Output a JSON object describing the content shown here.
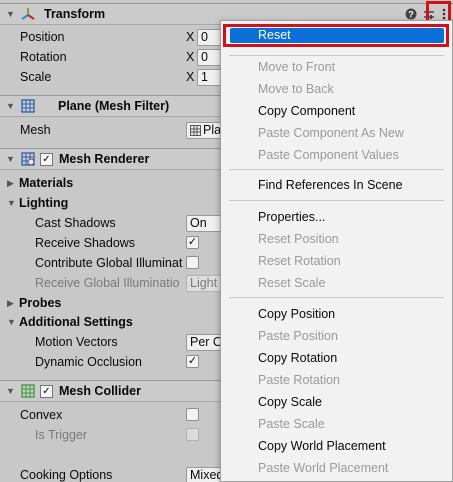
{
  "transform": {
    "title": "Transform",
    "position_label": "Position",
    "rotation_label": "Rotation",
    "scale_label": "Scale",
    "axis_x": "X",
    "position_x": "0",
    "rotation_x": "0",
    "scale_x": "1"
  },
  "plane": {
    "title": "Plane (Mesh Filter)",
    "mesh_label": "Mesh",
    "mesh_value": "Pla"
  },
  "renderer": {
    "title": "Mesh Renderer",
    "materials": "Materials",
    "lighting": "Lighting",
    "cast_shadows_label": "Cast Shadows",
    "cast_shadows_value": "On",
    "receive_shadows_label": "Receive Shadows",
    "contribute_gi_label": "Contribute Global Illuminat",
    "receive_gi_label": "Receive Global Illuminatio",
    "receive_gi_value": "Light",
    "probes": "Probes",
    "additional": "Additional Settings",
    "motion_vectors_label": "Motion Vectors",
    "motion_vectors_value": "Per O",
    "dynamic_occlusion_label": "Dynamic Occlusion",
    "check_mark": "✓"
  },
  "collider": {
    "title": "Mesh Collider",
    "convex_label": "Convex",
    "is_trigger_label": "Is Trigger",
    "cooking_label": "Cooking Options",
    "cooking_value": "Mixed"
  },
  "menu": {
    "items": [
      {
        "label": "Reset",
        "state": "selected"
      },
      {
        "label": "Move to Front",
        "state": "disabled"
      },
      {
        "label": "Move to Back",
        "state": "disabled"
      },
      {
        "label": "Copy Component",
        "state": "enabled"
      },
      {
        "label": "Paste Component As New",
        "state": "disabled"
      },
      {
        "label": "Paste Component Values",
        "state": "disabled"
      },
      {
        "label": "Find References In Scene",
        "state": "enabled"
      },
      {
        "label": "Properties...",
        "state": "enabled"
      },
      {
        "label": "Reset Position",
        "state": "disabled"
      },
      {
        "label": "Reset Rotation",
        "state": "disabled"
      },
      {
        "label": "Reset Scale",
        "state": "disabled"
      },
      {
        "label": "Copy Position",
        "state": "enabled"
      },
      {
        "label": "Paste Position",
        "state": "disabled"
      },
      {
        "label": "Copy Rotation",
        "state": "enabled"
      },
      {
        "label": "Paste Rotation",
        "state": "disabled"
      },
      {
        "label": "Copy Scale",
        "state": "enabled"
      },
      {
        "label": "Paste Scale",
        "state": "disabled"
      },
      {
        "label": "Copy World Placement",
        "state": "enabled"
      },
      {
        "label": "Paste World Placement",
        "state": "disabled"
      }
    ]
  },
  "icons": {
    "help": "help-icon",
    "presets": "presets-icon",
    "more": "kebab-menu-icon"
  },
  "colors": {
    "selection": "#0a6fd6",
    "highlight": "#d0101a",
    "panel_bg": "#c8c8c8",
    "menu_bg": "#f2f2f2"
  }
}
